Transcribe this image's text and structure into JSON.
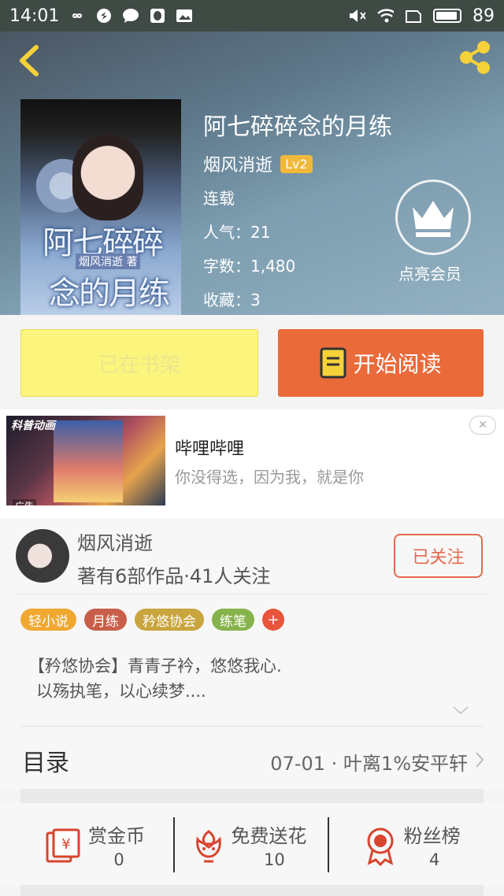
{
  "status_bar": {
    "time": "14:01",
    "battery": "89"
  },
  "book": {
    "title": "阿七碎碎念的月练",
    "author": "烟风消逝",
    "level": "Lv2",
    "status": "连载",
    "popularity_label": "人气：21",
    "words_label": "字数：1,480",
    "favorites_label": "收藏：3",
    "cover": {
      "title_line1": "阿七碎碎",
      "title_line2": "念的月练",
      "author": "烟风消逝 著"
    }
  },
  "vip": {
    "label": "点亮会员"
  },
  "actions": {
    "shelf_label": "已在书架",
    "read_label": "开始阅读"
  },
  "ad": {
    "title": "哔哩哔哩",
    "description": "你没得选，因为我，就是你",
    "tag": "广告",
    "close": "✕",
    "brand": "科普动画"
  },
  "author_card": {
    "name": "烟风消逝",
    "stats": "著有6部作品·41人关注",
    "follow_label": "已关注",
    "tags": [
      {
        "label": "轻小说",
        "color": "#f0a830"
      },
      {
        "label": "月练",
        "color": "#c95f4a"
      },
      {
        "label": "矜悠协会",
        "color": "#c9a53d"
      },
      {
        "label": "练笔",
        "color": "#86b34c"
      }
    ],
    "tag_add": "+",
    "description_line1": "【矜悠协会】青青子衿，悠悠我心.",
    "description_line2": "以殇执笔，以心续梦...."
  },
  "catalog": {
    "label": "目录",
    "latest": "07-01 · 叶离1%安平轩"
  },
  "rewards": [
    {
      "label": "赏金币",
      "value": "0",
      "icon": "red-envelope-icon"
    },
    {
      "label": "免费送花",
      "value": "10",
      "icon": "flower-icon"
    },
    {
      "label": "粉丝榜",
      "value": "4",
      "icon": "medal-icon"
    }
  ],
  "colors": {
    "accent_orange": "#ea6a3a",
    "shelf_yellow": "#fbf47d",
    "follow_red": "#e46a4d",
    "icon_red": "#d8452e"
  }
}
